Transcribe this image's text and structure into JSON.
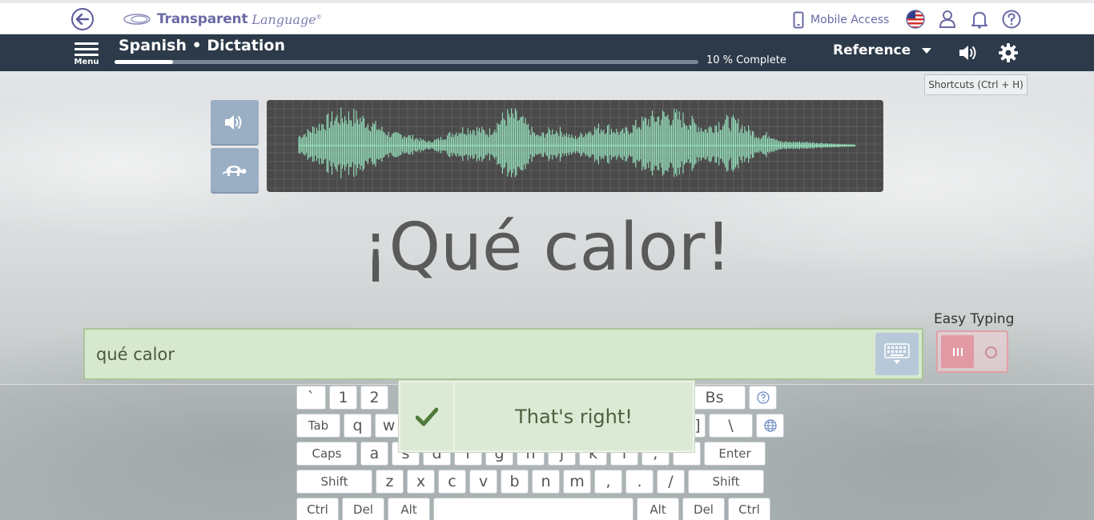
{
  "header": {
    "logo_brand": "Transparent",
    "logo_word": "Language",
    "logo_reg": "®",
    "mobile_access": "Mobile Access"
  },
  "nav": {
    "menu_label": "Menu",
    "course_title": "Spanish • Dictation",
    "progress_percent": 10,
    "progress_text": "10 % Complete",
    "reference_label": "Reference"
  },
  "shortcuts": "Shortcuts (Ctrl + H)",
  "phrase": "¡Qué calor!",
  "answer": {
    "value": "qué calor"
  },
  "easy_typing": {
    "label": "Easy Typing",
    "enabled": true
  },
  "feedback": {
    "message": "That's right!"
  },
  "keyboard": {
    "row1": [
      "`",
      "1",
      "2",
      "Bs"
    ],
    "row2": [
      "Tab",
      "q",
      "w",
      "]",
      "\\"
    ],
    "row3": [
      "Caps",
      "a",
      "s",
      "d",
      "f",
      "g",
      "h",
      "j",
      "k",
      "l",
      ";",
      "Enter"
    ],
    "row4": [
      "Shift",
      "z",
      "x",
      "c",
      "v",
      "b",
      "n",
      "m",
      ",",
      ".",
      "/",
      "Shift"
    ],
    "row5": [
      "Ctrl",
      "Del",
      "Alt",
      "Alt",
      "Del",
      "Ctrl"
    ]
  },
  "colors": {
    "nav_bg": "#2c3a4a",
    "brand": "#6a6aa6",
    "correct_bg": "#d6e8cd",
    "waveform": "#9ef0c8",
    "easy_toggle": "#e19aa3"
  },
  "icons": {
    "back": "back-arrow-icon",
    "phone": "phone-icon",
    "flag": "us-flag-icon",
    "user": "user-icon",
    "bell": "bell-icon",
    "help": "help-icon",
    "speaker": "speaker-icon",
    "gear": "gear-icon",
    "turtle": "turtle-icon",
    "keyboard": "keyboard-icon",
    "check": "check-icon",
    "globe": "globe-icon"
  }
}
